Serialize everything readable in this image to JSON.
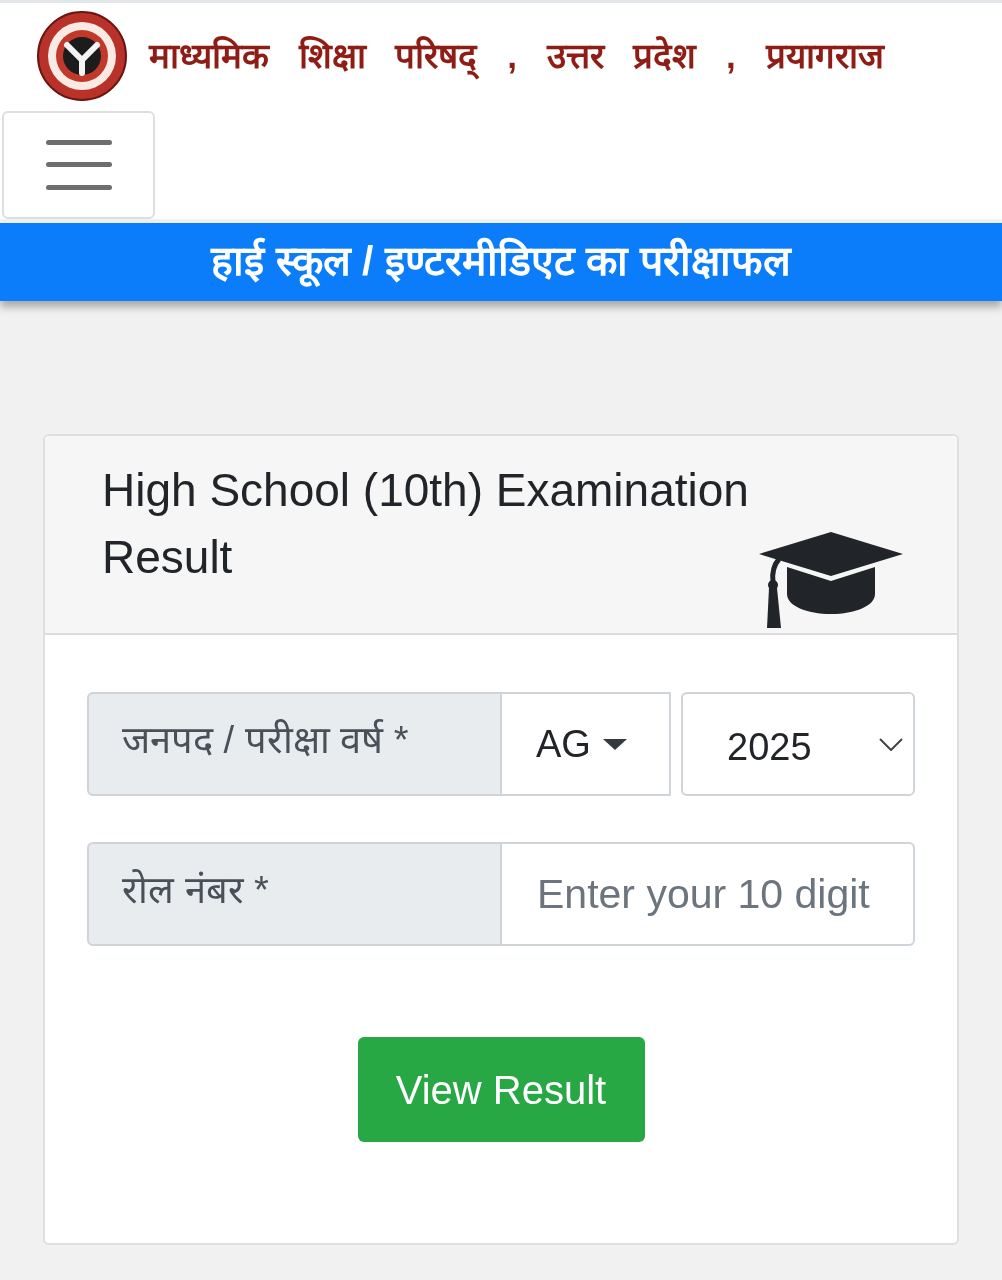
{
  "header": {
    "title": "माध्यमिक शिक्षा परिषद् , उत्तर प्रदेश , प्रयागराज"
  },
  "banner": {
    "title": "हाई स्कूल / इण्टरमीडिएट का परीक्षाफल"
  },
  "card": {
    "title": "High School (10th) Examination Result",
    "rows": [
      {
        "label": "जनपद / परीक्षा वर्ष *",
        "controls": [
          {
            "kind": "dropdown",
            "value": "AG"
          },
          {
            "kind": "select",
            "value": "2025"
          }
        ]
      },
      {
        "label": "रोल नंबर *",
        "controls": [
          {
            "kind": "text",
            "placeholder": "Enter your 10 digit"
          }
        ]
      }
    ],
    "submit": {
      "label": "View Result"
    }
  }
}
